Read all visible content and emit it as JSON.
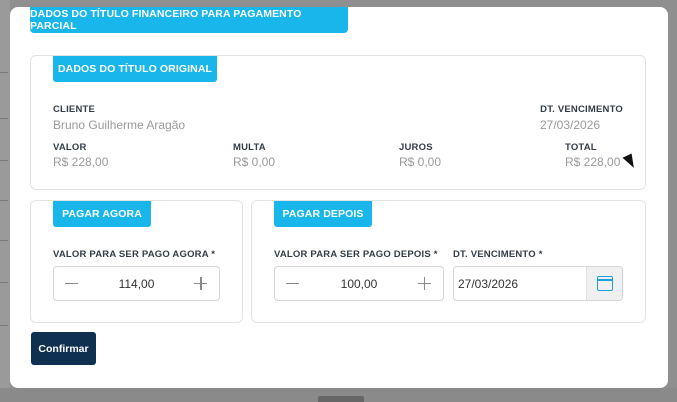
{
  "modal": {
    "title": "DADOS DO TÍTULO FINANCEIRO PARA PAGAMENTO PARCIAL"
  },
  "original": {
    "section_title": "DADOS DO TÍTULO ORIGINAL",
    "cliente_label": "CLIENTE",
    "cliente_value": "Bruno Guilherme Aragão",
    "vencimento_label": "DT. VENCIMENTO",
    "vencimento_value": "27/03/2026",
    "valor_label": "VALOR",
    "valor_value": "R$ 228,00",
    "multa_label": "MULTA",
    "multa_value": "R$ 0,00",
    "juros_label": "JUROS",
    "juros_value": "R$ 0,00",
    "total_label": "TOTAL",
    "total_value": "R$ 228,00"
  },
  "pagar_agora": {
    "section_title": "PAGAR AGORA",
    "valor_label": "VALOR PARA SER PAGO AGORA *",
    "valor_value": "114,00"
  },
  "pagar_depois": {
    "section_title": "PAGAR DEPOIS",
    "valor_label": "VALOR PARA SER PAGO DEPOIS *",
    "valor_value": "100,00",
    "vencimento_label": "DT. VENCIMENTO *",
    "vencimento_value": "27/03/2026"
  },
  "actions": {
    "confirm_label": "Confirmar"
  },
  "icons": {
    "minus": "minus-icon",
    "plus": "plus-icon",
    "calendar": "calendar-icon"
  },
  "colors": {
    "accent": "#18b6ea",
    "primary_button": "#0f3050",
    "label": "#333d47",
    "value": "#9a9a9a"
  }
}
